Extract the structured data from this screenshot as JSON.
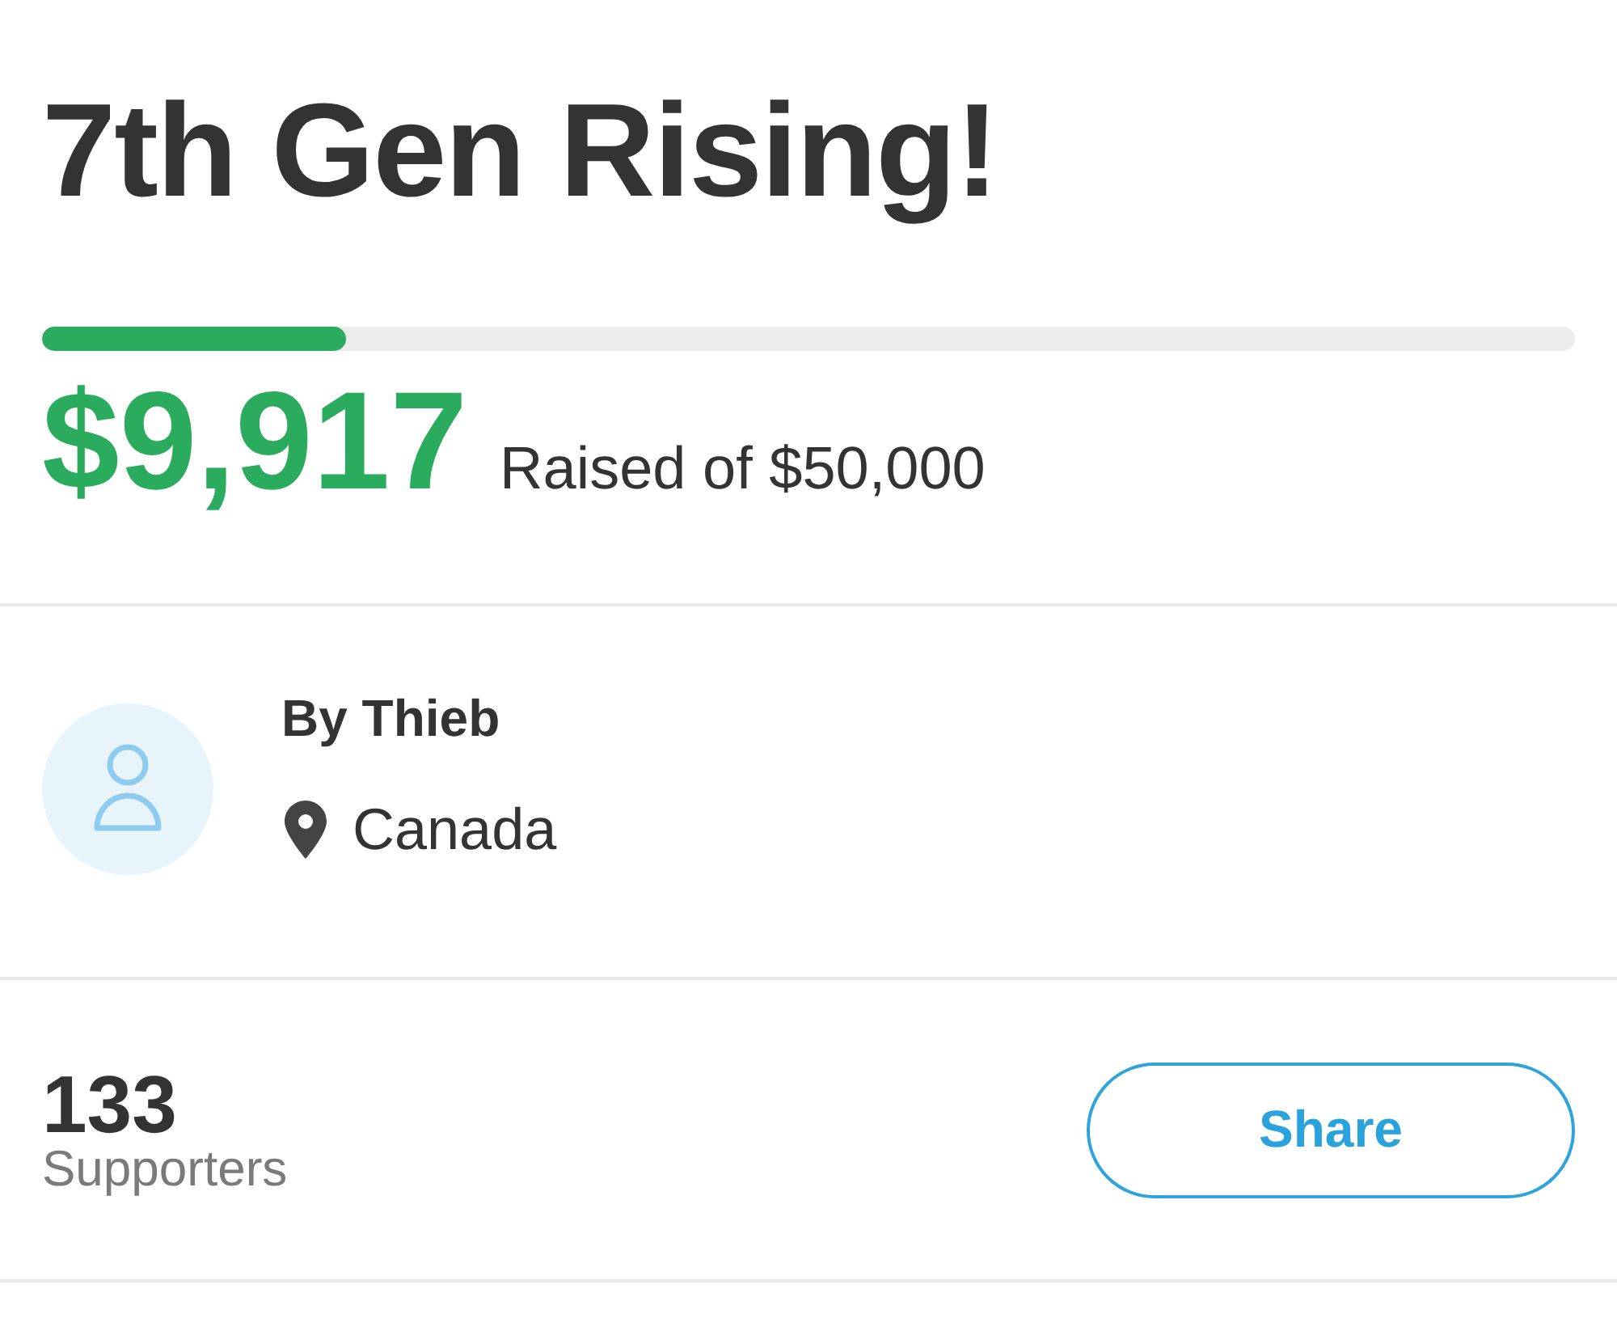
{
  "campaign": {
    "title": "7th Gen Rising!",
    "progress": {
      "level": 0.198
    },
    "amount_raised": "$9,917",
    "goal_text": "Raised of $50,000"
  },
  "organizer": {
    "name": "By Thieb",
    "location": "Canada"
  },
  "supporters": {
    "count": "133",
    "label": "Supporters"
  },
  "share_button": {
    "label": "Share"
  }
}
